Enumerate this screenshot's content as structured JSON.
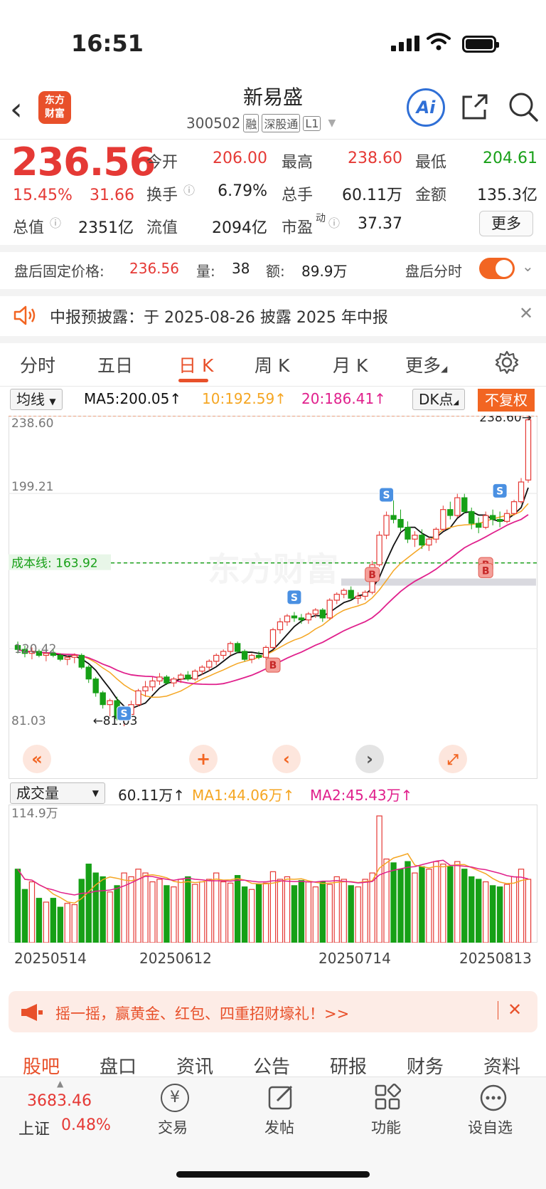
{
  "status": {
    "time": "16:51"
  },
  "header": {
    "back": "‹",
    "logo_line1": "东方",
    "logo_line2": "财富",
    "name": "新易盛",
    "code": "300502",
    "tags": [
      "融",
      "深股通",
      "L1"
    ],
    "ai_label": "Ai"
  },
  "quote": {
    "price": "236.56",
    "change_pct": "15.45%",
    "change": "31.66",
    "open_label": "今开",
    "open": "206.00",
    "high_label": "最高",
    "high": "238.60",
    "low_label": "最低",
    "low": "204.61",
    "turnover_label": "换手",
    "turnover": "6.79%",
    "volume_label": "总手",
    "volume": "60.11万",
    "amount_label": "金额",
    "amount": "135.3亿",
    "mktcap_label": "总值",
    "mktcap": "2351亿",
    "float_label": "流值",
    "float": "2094亿",
    "pe_label": "市盈",
    "pe_sup": "动",
    "pe": "37.37",
    "more": "更多"
  },
  "afterhours": {
    "label": "盘后固定价格:",
    "price": "236.56",
    "vol_label": "量:",
    "vol": "38",
    "amt_label": "额:",
    "amt": "89.9万",
    "toggle_label": "盘后分时",
    "toggle_on": true
  },
  "notice": {
    "text": "中报预披露：于 2025-08-26 披露 2025 年中报"
  },
  "tabs": [
    {
      "label": "分时"
    },
    {
      "label": "五日"
    },
    {
      "label": "日 K",
      "active": true
    },
    {
      "label": "周 K"
    },
    {
      "label": "月 K"
    },
    {
      "label": "更多"
    }
  ],
  "indicators": {
    "ma_select": "均线",
    "ma5": "MA5:200.05",
    "ma10": "10:192.59",
    "ma20": "20:186.41",
    "dk": "DK点",
    "fq": "不复权",
    "arrow": "↑"
  },
  "colors": {
    "up": "#e53935",
    "down": "#16a016",
    "ma5": "#111111",
    "ma10": "#f5a623",
    "ma20": "#e0208c",
    "accent": "#f26522"
  },
  "chart_data": {
    "type": "candlestick",
    "price_max_label": "238.60",
    "price_mid_label": "199.21",
    "price_min_label": "81.03",
    "price_partial_label": "120.42",
    "cost_line_label": "163.92",
    "cost_line_prefix": "成本线",
    "high_marker": "238.60→",
    "low_marker": "←81.03",
    "ylim": [
      81.03,
      238.6
    ],
    "candles": [
      [
        122,
        124,
        118,
        120
      ],
      [
        120,
        122,
        116,
        118
      ],
      [
        118,
        121,
        115,
        119
      ],
      [
        119,
        120,
        116,
        117
      ],
      [
        117,
        119,
        114,
        118
      ],
      [
        118,
        120,
        116,
        117
      ],
      [
        117,
        118,
        114,
        115
      ],
      [
        115,
        117,
        112,
        116
      ],
      [
        116,
        118,
        113,
        117
      ],
      [
        117,
        118,
        110,
        111
      ],
      [
        111,
        112,
        103,
        105
      ],
      [
        105,
        106,
        96,
        98
      ],
      [
        98,
        99,
        90,
        92
      ],
      [
        92,
        95,
        86,
        94
      ],
      [
        94,
        96,
        84,
        85
      ],
      [
        85,
        88,
        81.03,
        87
      ],
      [
        87,
        94,
        86,
        92
      ],
      [
        92,
        100,
        91,
        99
      ],
      [
        99,
        104,
        96,
        101
      ],
      [
        101,
        106,
        99,
        104
      ],
      [
        104,
        108,
        102,
        106
      ],
      [
        106,
        107,
        102,
        103
      ],
      [
        103,
        106,
        101,
        105
      ],
      [
        105,
        108,
        103,
        107
      ],
      [
        107,
        109,
        104,
        105
      ],
      [
        105,
        110,
        104,
        109
      ],
      [
        109,
        112,
        107,
        111
      ],
      [
        111,
        115,
        109,
        114
      ],
      [
        114,
        118,
        112,
        117
      ],
      [
        117,
        120,
        115,
        119
      ],
      [
        119,
        124,
        117,
        123
      ],
      [
        123,
        124,
        118,
        119
      ],
      [
        119,
        120,
        114,
        115
      ],
      [
        115,
        118,
        113,
        117
      ],
      [
        117,
        119,
        115,
        116
      ],
      [
        116,
        122,
        115,
        121
      ],
      [
        121,
        131,
        120,
        130
      ],
      [
        130,
        136,
        128,
        134
      ],
      [
        134,
        138,
        132,
        137
      ],
      [
        137,
        139,
        134,
        136
      ],
      [
        136,
        138,
        133,
        135
      ],
      [
        135,
        139,
        133,
        138
      ],
      [
        138,
        141,
        136,
        140
      ],
      [
        140,
        141,
        134,
        136
      ],
      [
        136,
        146,
        135,
        145
      ],
      [
        145,
        149,
        143,
        148
      ],
      [
        148,
        151,
        146,
        150
      ],
      [
        150,
        152,
        145,
        146
      ],
      [
        146,
        149,
        143,
        147
      ],
      [
        147,
        150,
        145,
        149
      ],
      [
        149,
        165,
        148,
        163
      ],
      [
        163,
        180,
        162,
        178
      ],
      [
        178,
        190,
        176,
        188
      ],
      [
        188,
        196,
        184,
        186
      ],
      [
        186,
        191,
        180,
        182
      ],
      [
        182,
        185,
        174,
        176
      ],
      [
        176,
        180,
        172,
        178
      ],
      [
        178,
        181,
        171,
        173
      ],
      [
        173,
        177,
        170,
        176
      ],
      [
        176,
        182,
        174,
        181
      ],
      [
        181,
        193,
        180,
        191
      ],
      [
        191,
        195,
        186,
        188
      ],
      [
        188,
        199,
        187,
        197
      ],
      [
        197,
        199,
        189,
        190
      ],
      [
        190,
        192,
        181,
        184
      ],
      [
        184,
        187,
        179,
        182
      ],
      [
        182,
        190,
        181,
        188
      ],
      [
        188,
        191,
        183,
        186
      ],
      [
        186,
        190,
        182,
        185
      ],
      [
        185,
        191,
        184,
        189
      ],
      [
        189,
        196,
        188,
        195
      ],
      [
        195,
        207,
        194,
        205
      ],
      [
        206,
        238.6,
        204.61,
        236.56
      ]
    ],
    "buy_label": "B",
    "sell_label": "S"
  },
  "volume": {
    "select": "成交量",
    "total": "60.11万",
    "ma1": "MA1:44.06万",
    "ma2": "MA2:45.43万",
    "max_label": "114.9万",
    "bars": [
      58,
      42,
      48,
      35,
      32,
      35,
      28,
      31,
      30,
      50,
      62,
      55,
      52,
      40,
      45,
      55,
      52,
      58,
      55,
      48,
      50,
      45,
      44,
      50,
      52,
      46,
      48,
      50,
      55,
      48,
      47,
      53,
      44,
      42,
      46,
      47,
      56,
      50,
      52,
      45,
      49,
      48,
      44,
      48,
      46,
      52,
      50,
      45,
      44,
      50,
      55,
      100,
      66,
      63,
      58,
      64,
      55,
      60,
      58,
      64,
      62,
      60,
      64,
      58,
      52,
      50,
      48,
      45,
      44,
      46,
      52,
      58,
      50
    ]
  },
  "dates": [
    "20250514",
    "20250612",
    "20250714",
    "20250813"
  ],
  "banner": {
    "text": "摇一摇，赢黄金、红包、四重招财壕礼！>>"
  },
  "bottom_tabs": [
    "股吧",
    "盘口",
    "资讯",
    "公告",
    "研报",
    "财务",
    "资料"
  ],
  "bottom_nav": {
    "index_value": "3683.46",
    "index_name": "上证",
    "index_change": "0.48%",
    "trade": "交易",
    "post": "发帖",
    "func": "功能",
    "watch": "设自选"
  },
  "watermark": "东方财富"
}
